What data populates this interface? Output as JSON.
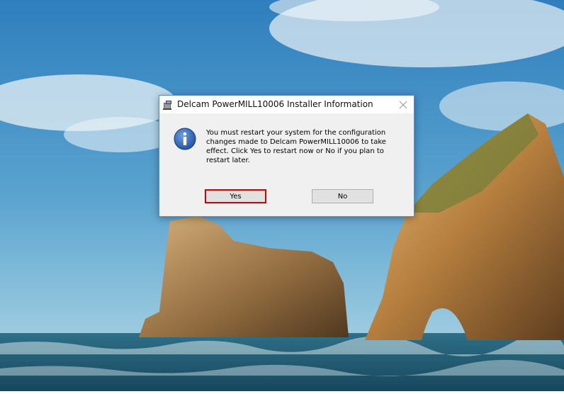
{
  "dialog": {
    "title": "Delcam PowerMILL10006 Installer Information",
    "message": "You must restart your system for the configuration changes made to Delcam PowerMILL10006 to take effect. Click Yes to restart now or No if you plan to restart later.",
    "yes_label": "Yes",
    "no_label": "No",
    "title_icon": "installer-icon",
    "message_icon": "info-icon",
    "highlight_color": "#d10000"
  }
}
